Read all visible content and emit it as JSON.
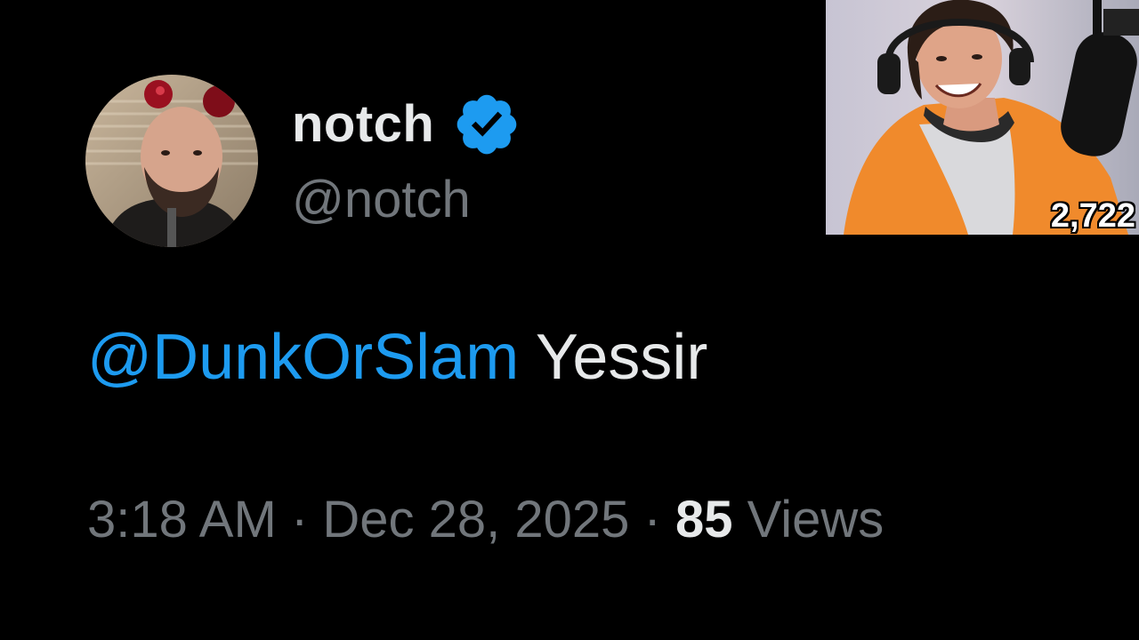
{
  "tweet": {
    "display_name": "notch",
    "verified": true,
    "handle": "@notch",
    "mention": "@DunkOrSlam",
    "text": "Yessir",
    "time": "3:18 AM",
    "separator": "·",
    "date": "Dec 28, 2025",
    "views_count": "85",
    "views_label": "Views"
  },
  "stream": {
    "viewer_count": "2,722"
  },
  "colors": {
    "background": "#000000",
    "text_primary": "#e7e9ea",
    "text_secondary": "#71767b",
    "accent_blue": "#1d9bf0"
  },
  "icons": {
    "verified": "verified-badge-icon",
    "avatar": "profile-avatar-photo",
    "webcam": "webcam-feed"
  }
}
